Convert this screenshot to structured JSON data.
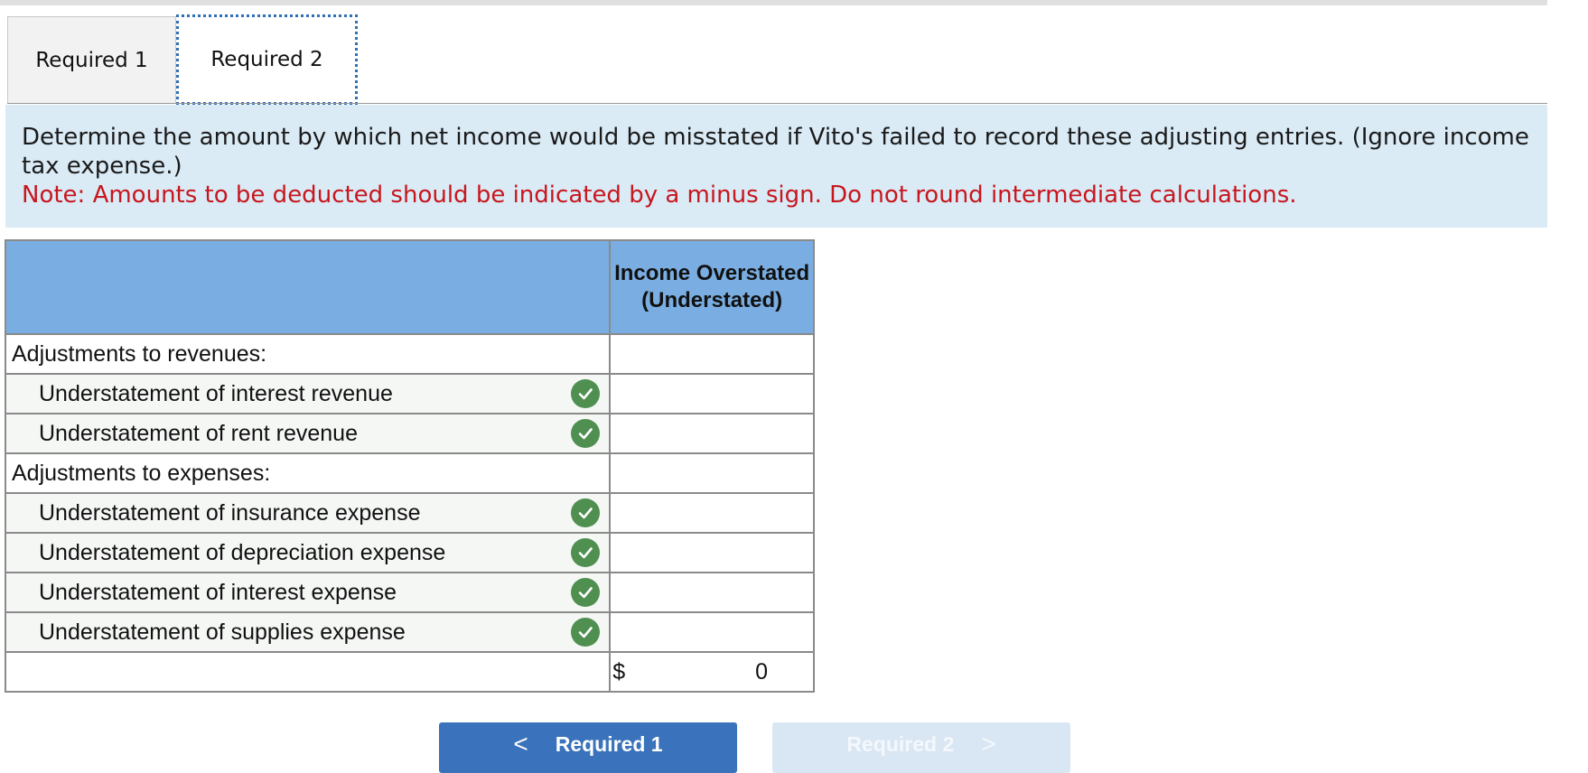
{
  "tabs": [
    {
      "label": "Required 1",
      "active": false
    },
    {
      "label": "Required 2",
      "active": true
    }
  ],
  "instructions": {
    "main": "Determine the amount by which net income would be misstated if Vito's failed to record these adjusting entries. (Ignore income tax expense.)",
    "note": "Note: Amounts to be deducted should be indicated by a minus sign. Do not round intermediate calculations."
  },
  "table": {
    "header": {
      "col1": "",
      "col2": "Income Overstated (Understated)"
    },
    "rows": [
      {
        "label": "Adjustments to revenues:",
        "type": "section",
        "value": "",
        "check": false
      },
      {
        "label": "Understatement of interest revenue",
        "type": "item",
        "value": "",
        "check": true
      },
      {
        "label": "Understatement of rent revenue",
        "type": "item",
        "value": "",
        "check": true
      },
      {
        "label": "Adjustments to expenses:",
        "type": "section",
        "value": "",
        "check": false
      },
      {
        "label": "Understatement of insurance expense",
        "type": "item",
        "value": "",
        "check": true
      },
      {
        "label": "Understatement of depreciation expense",
        "type": "item",
        "value": "",
        "check": true
      },
      {
        "label": "Understatement of interest expense",
        "type": "item",
        "value": "",
        "check": true
      },
      {
        "label": "Understatement of supplies expense",
        "type": "item",
        "value": "",
        "check": true
      }
    ],
    "total": {
      "currency": "$",
      "value": "0"
    }
  },
  "nav": {
    "prev_label": "Required 1",
    "next_label": "Required 2"
  },
  "colors": {
    "header_bg": "#7aaee2",
    "instructions_bg": "#daebf6",
    "note_text": "#c8161d",
    "check_green": "#4f8f50",
    "prev_button": "#3a73bb",
    "next_button_disabled": "#d9e6f3"
  }
}
